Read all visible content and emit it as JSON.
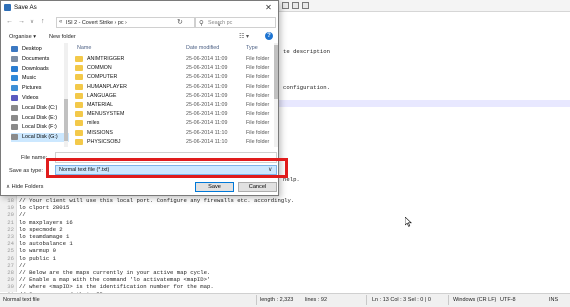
{
  "dialog": {
    "title": "Save As",
    "close_glyph": "✕",
    "address": {
      "path": "ISI 2 - Covert Strike  ›  pc  ›",
      "prefix": "«"
    },
    "search_placeholder": "Search pc",
    "organise_label": "Organise ▾",
    "new_folder_label": "New folder",
    "nav_items": [
      {
        "label": "Desktop",
        "icon": "desktop-icon",
        "color": "#3b78c2"
      },
      {
        "label": "Documents",
        "icon": "documents-icon",
        "color": "#7c8ea6"
      },
      {
        "label": "Downloads",
        "icon": "downloads-icon",
        "color": "#2a7dd2"
      },
      {
        "label": "Music",
        "icon": "music-icon",
        "color": "#2f88d8"
      },
      {
        "label": "Pictures",
        "icon": "pictures-icon",
        "color": "#3d8fd6"
      },
      {
        "label": "Videos",
        "icon": "videos-icon",
        "color": "#5a5ac0"
      },
      {
        "label": "Local Disk (C:)",
        "icon": "drive-icon",
        "color": "#8a8a8a"
      },
      {
        "label": "Local Disk (E:)",
        "icon": "drive-icon",
        "color": "#8a8a8a"
      },
      {
        "label": "Local Disk (F:)",
        "icon": "drive-icon",
        "color": "#8a8a8a"
      },
      {
        "label": "Local Disk (G:)",
        "icon": "drive-icon",
        "color": "#8a8a8a"
      }
    ],
    "columns": {
      "name": "Name",
      "date": "Date modified",
      "type": "Type"
    },
    "files": [
      {
        "name": "ANIMTRIGGER",
        "date": "25-06-2014 11:09",
        "type": "File folder"
      },
      {
        "name": "COMMON",
        "date": "25-06-2014 11:09",
        "type": "File folder"
      },
      {
        "name": "COMPUTER",
        "date": "25-06-2014 11:09",
        "type": "File folder"
      },
      {
        "name": "HUMANPLAYER",
        "date": "25-06-2014 11:09",
        "type": "File folder"
      },
      {
        "name": "LANGUAGE",
        "date": "25-06-2014 11:09",
        "type": "File folder"
      },
      {
        "name": "MATERIAL",
        "date": "25-06-2014 11:09",
        "type": "File folder"
      },
      {
        "name": "MENUSYSTEM",
        "date": "25-06-2014 11:09",
        "type": "File folder"
      },
      {
        "name": "miles",
        "date": "25-06-2014 11:09",
        "type": "File folder"
      },
      {
        "name": "MISSIONS",
        "date": "25-06-2014 11:10",
        "type": "File folder"
      },
      {
        "name": "PHYSICSOBJ",
        "date": "25-06-2014 11:10",
        "type": "File folder"
      }
    ],
    "filename_label": "File name:",
    "filename_value": "",
    "save_type_label": "Save as type:",
    "save_type_value": "Normal text file (*.txt)",
    "hide_folders_label": "Hide Folders",
    "save_label": "Save",
    "cancel_label": "Cancel"
  },
  "editor": {
    "visible_fragments": [
      {
        "text": "te description",
        "line": ""
      },
      {
        "text": "configuration.",
        "line": ""
      },
      {
        "text": "help.",
        "line": ""
      }
    ],
    "lines": [
      {
        "num": "18",
        "text": "// Your client will use this local port. Configure any firewalls etc. accordingly."
      },
      {
        "num": "19",
        "text": "lo clport 28015"
      },
      {
        "num": "20",
        "text": "//"
      },
      {
        "num": "21",
        "text": "lo maxplayers 16"
      },
      {
        "num": "22",
        "text": "lo specmode 2"
      },
      {
        "num": "23",
        "text": "lo teamdamage 1"
      },
      {
        "num": "24",
        "text": "lo autobalance 1"
      },
      {
        "num": "25",
        "text": "lo warmup 0"
      },
      {
        "num": "26",
        "text": "lo public 1"
      },
      {
        "num": "27",
        "text": "//"
      },
      {
        "num": "28",
        "text": "// Below are the maps currently in your active map cycle."
      },
      {
        "num": "29",
        "text": "// Enable a map with the command 'lo activatemap <mapID>'"
      },
      {
        "num": "30",
        "text": "// where <mapID> is the identification number for the map."
      },
      {
        "num": "31",
        "text": "// Some maps and their IDs:"
      }
    ]
  },
  "statusbar": {
    "file_type": "Normal text file",
    "length": "length : 2,323",
    "lines": "lines : 92",
    "position": "Ln : 13   Col : 3   Sel : 0 | 0",
    "eol": "Windows (CR LF)",
    "encoding": "UTF-8",
    "mode": "INS"
  },
  "colors": {
    "highlight_red": "#e01c1c",
    "selection_blue": "#cce8ff",
    "folder_yellow": "#f3c94a"
  }
}
